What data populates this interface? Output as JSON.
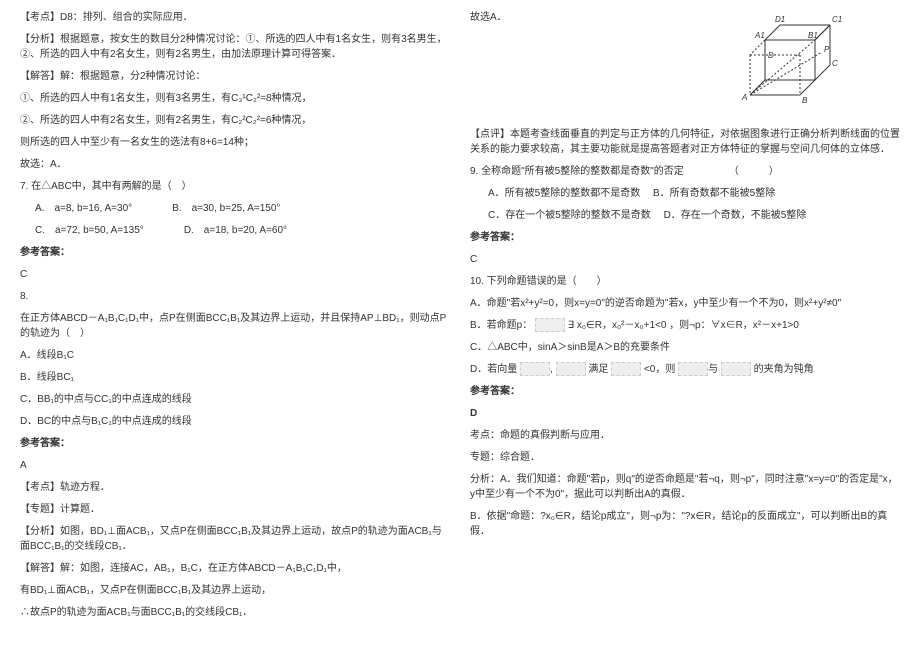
{
  "left": {
    "kaodian": "【考点】D8：排列、组合的实际应用．",
    "fenxi": "【分析】根据题意，按女生的数目分2种情况讨论：①、所选的四人中有1名女生，则有3名男生，②、所选的四人中有2名女生，则有2名男生，由加法原理计算可得答案．",
    "jieda_head": "【解答】解：根据题意，分2种情况讨论：",
    "case1": "①、所选的四人中有1名女生，则有3名男生，有C₃¹C₂²=8种情况，",
    "case2": "②、所选的四人中有2名女生，则有2名男生，有C₂²C₂²=6种情况，",
    "case_sum": "则所选的四人中至少有一名女生的选法有8+6=14种；",
    "guxuan": "故选：A．",
    "q7_stem": "7. 在△ABC中，其中有两解的是（　）",
    "q7_a": "A.　a=8, b=16, A=30°",
    "q7_b": "B.　a=30, b=25, A=150°",
    "q7_c": "C.　a=72, b=50, A=135°",
    "q7_d": "D.　a=18, b=20, A=60°",
    "q7_ref": "参考答案：",
    "q7_ans": "C",
    "q8_num": "8.",
    "q8_stem": "在正方体ABCD－A₁B₁C₁D₁中，点P在侧面BCC₁B₁及其边界上运动，并且保持AP⊥BD₁，则动点P的轨迹为（　）",
    "q8_a": "A．线段B₁C",
    "q8_b": "B．线段BC₁",
    "q8_c": "C．BB₁的中点与CC₁的中点连成的线段",
    "q8_d": "D．BC的中点与B₁C₁的中点连成的线段",
    "q8_ref": "参考答案：",
    "q8_ans": "A",
    "q8_kaodian": "【考点】轨迹方程．",
    "q8_zhuanti": "【专题】计算题．",
    "q8_fenxi": "【分析】如图，BD₁⊥面ACB₁，又点P在侧面BCC₁B₁及其边界上运动，故点P的轨迹为面ACB₁与面BCC₁B₁的交线段CB₁．",
    "q8_jieda1": "【解答】解：如图，连接AC，AB₁，B₁C，在正方体ABCD－A₁B₁C₁D₁中，",
    "q8_jieda2": "有BD₁⊥面ACB₁，又点P在侧面BCC₁B₁及其边界上运动，",
    "q8_jieda3": "∴故点P的轨迹为面ACB₁与面BCC₁B₁的交线段CB₁．"
  },
  "right": {
    "guxuan_a": "故选A．",
    "dianping": "【点评】本题考查线面垂直的判定与正方体的几何特征，对依据图象进行正确分析判断线面的位置关系的能力要求较高，其主要功能就是提高答题者对正方体特征的掌握与空间几何体的立体感．",
    "q9_stem": "9. 全称命题\"所有被5整除的整数都是奇数\"的否定　　　　　（　　　）",
    "q9_a": "A．所有被5整除的整数都不是奇数",
    "q9_b": "B．所有奇数都不能被5整除",
    "q9_c": "C．存在一个被5整除的整数不是奇数",
    "q9_d": "D．存在一个奇数，不能被5整除",
    "q9_ref": "参考答案：",
    "q9_ans": "C",
    "q10_stem": "10. 下列命题错误的是（　　）",
    "q10_a": "A．命题\"若x²+y²=0，则x=y=0\"的逆否命题为\"若x，y中至少有一个不为0，则x²+y²≠0\"",
    "q10_b_head": "B．若命题p：",
    "q10_b_mid": "，则¬p：∀x∈R，x²－x+1>0",
    "q10_c": "C．△ABC中，sinA＞sinB是A＞B的充要条件",
    "q10_d_head": "D．若向量",
    "q10_d_mid": "满足",
    "q10_d_tail": "<0，则",
    "q10_d_end": "的夹角为钝角",
    "q10_ref": "参考答案：",
    "q10_ans": "D",
    "q10_kaodian": "考点：命题的真假判断与应用．",
    "q10_zhuanti": "专题：综合题．",
    "q10_fenxi_a": "分析：A．我们知道：命题\"若p，则q\"的逆否命题是\"若¬q，则¬p\"，同时注意\"x=y=0\"的否定是\"x，y中至少有一个不为0\"，据此可以判断出A的真假．",
    "q10_fenxi_b": "B．依据\"命题：?x₀∈R，结论p成立\"，则¬p为：\"?x∈R，结论p的反面成立\"，可以判断出B的真假．",
    "diagram_labels": {
      "d1": "D1",
      "c1": "C1",
      "a1": "A1",
      "b1": "B1",
      "p": "P",
      "d": "D",
      "c": "C",
      "a": "A",
      "b": "B"
    }
  }
}
